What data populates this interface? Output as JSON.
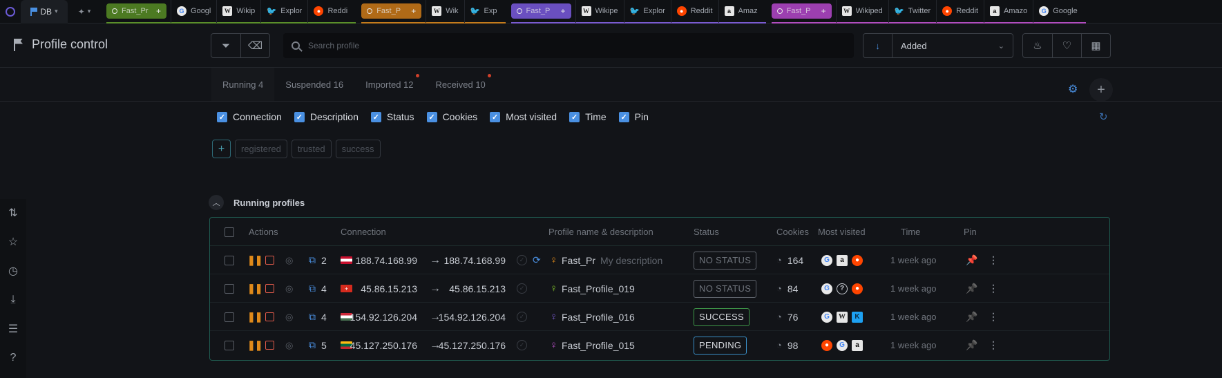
{
  "tabstrip": {
    "db_label": "DB",
    "groups": [
      {
        "color": "#4c7a22",
        "fast_label": "Fast_Pr",
        "sites": [
          {
            "icon": "google",
            "label": "Googl"
          },
          {
            "icon": "wikipedia",
            "label": "Wikip"
          },
          {
            "icon": "twitter",
            "label": "Explor"
          },
          {
            "icon": "reddit",
            "label": "Reddi"
          }
        ]
      },
      {
        "color": "#b06a17",
        "fast_label": "Fast_P",
        "sites": [
          {
            "icon": "wikipedia",
            "label": "Wik"
          },
          {
            "icon": "twitter",
            "label": "Exp"
          }
        ]
      },
      {
        "color": "#6a4fc0",
        "fast_label": "Fast_P",
        "sites": [
          {
            "icon": "wikipedia",
            "label": "Wikipe"
          },
          {
            "icon": "twitter",
            "label": "Explor"
          },
          {
            "icon": "reddit",
            "label": "Reddit"
          },
          {
            "icon": "amazon",
            "label": "Amaz"
          }
        ]
      },
      {
        "color": "#9c3fb0",
        "fast_label": "Fast_P",
        "sites": [
          {
            "icon": "wikipedia",
            "label": "Wikiped"
          },
          {
            "icon": "twitter",
            "label": "Twitter"
          },
          {
            "icon": "reddit",
            "label": "Reddit"
          },
          {
            "icon": "amazon",
            "label": "Amazo"
          },
          {
            "icon": "google",
            "label": "Google"
          }
        ]
      }
    ]
  },
  "header": {
    "title": "Profile control",
    "search_placeholder": "Search profile",
    "sort_value": "Added"
  },
  "tabs": [
    {
      "label": "Running 4",
      "notif": false,
      "active": true
    },
    {
      "label": "Suspended 16",
      "notif": false,
      "active": false
    },
    {
      "label": "Imported 12",
      "notif": true,
      "active": false
    },
    {
      "label": "Received 10",
      "notif": true,
      "active": false
    }
  ],
  "column_toggles": [
    "Connection",
    "Description",
    "Status",
    "Cookies",
    "Most visited",
    "Time",
    "Pin"
  ],
  "tags": [
    "registered",
    "trusted",
    "success"
  ],
  "section_title": "Running profiles",
  "table": {
    "headers": {
      "actions": "Actions",
      "connection": "Connection",
      "profile": "Profile name & description",
      "status": "Status",
      "cookies": "Cookies",
      "most_visited": "Most visited",
      "time": "Time",
      "pin": "Pin"
    },
    "rows": [
      {
        "copies": "2",
        "flag": "austria",
        "ip_from": "188.74.168.99",
        "ip_to": "188.74.168.99",
        "syncing": true,
        "person_color": "#e08a1a",
        "name": "Fast_Pr",
        "description": "My description",
        "status": "NO STATUS",
        "status_color": "#5e636b",
        "cookies": "164",
        "visited": [
          "google",
          "amazon",
          "reddit"
        ],
        "time": "1 week ago",
        "pinned": true
      },
      {
        "copies": "4",
        "flag": "switzerland",
        "ip_from": "45.86.15.213",
        "ip_to": "45.86.15.213",
        "syncing": false,
        "person_color": "#7fbf2a",
        "name": "Fast_Profile_019",
        "description": "",
        "status": "NO STATUS",
        "status_color": "#5e636b",
        "cookies": "84",
        "visited": [
          "google",
          "unknown",
          "reddit"
        ],
        "time": "1 week ago",
        "pinned": false
      },
      {
        "copies": "4",
        "flag": "hungary",
        "ip_from": "154.92.126.204",
        "ip_to": "154.92.126.204",
        "syncing": false,
        "person_color": "#7a5bd1",
        "name": "Fast_Profile_016",
        "description": "",
        "status": "SUCCESS",
        "status_color": "#3f9a4a",
        "cookies": "76",
        "visited": [
          "google",
          "wikipedia",
          "klarna"
        ],
        "time": "1 week ago",
        "pinned": false
      },
      {
        "copies": "5",
        "flag": "lithuania",
        "ip_from": "45.127.250.176",
        "ip_to": "45.127.250.176",
        "syncing": false,
        "person_color": "#b14dbf",
        "name": "Fast_Profile_015",
        "description": "",
        "status": "PENDING",
        "status_color": "#3a8fc8",
        "cookies": "98",
        "visited": [
          "reddit",
          "google",
          "amazon"
        ],
        "time": "1 week ago",
        "pinned": false
      }
    ]
  }
}
